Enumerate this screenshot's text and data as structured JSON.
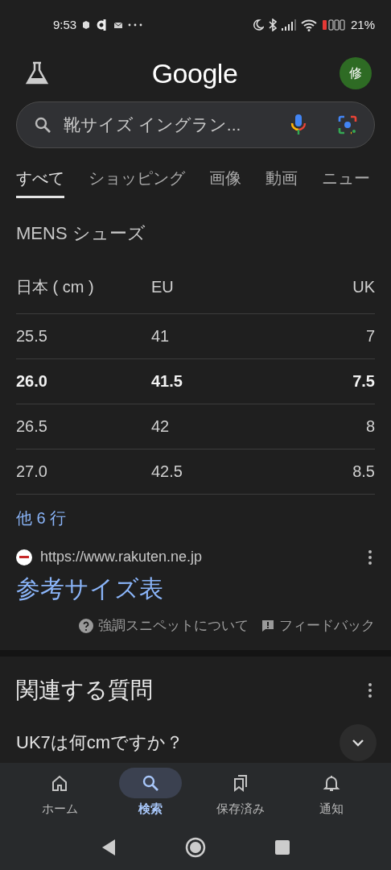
{
  "status_bar": {
    "time": "9:53",
    "battery": "21%"
  },
  "header": {
    "logo": "Google",
    "avatar": "修"
  },
  "search": {
    "value": "靴サイズ イングラン..."
  },
  "tabs": [
    {
      "label": "すべて",
      "selected": true
    },
    {
      "label": "ショッピング",
      "selected": false
    },
    {
      "label": "画像",
      "selected": false
    },
    {
      "label": "動画",
      "selected": false
    },
    {
      "label": "ニュー",
      "selected": false
    }
  ],
  "snippet": {
    "heading": "MENS シューズ",
    "table": {
      "columns": [
        "日本 ( cm )",
        "EU",
        "UK"
      ],
      "rows": [
        {
          "cells": [
            "25.5",
            "41",
            "7"
          ],
          "highlighted": false
        },
        {
          "cells": [
            "26.0",
            "41.5",
            "7.5"
          ],
          "highlighted": true
        },
        {
          "cells": [
            "26.5",
            "42",
            "8"
          ],
          "highlighted": false
        },
        {
          "cells": [
            "27.0",
            "42.5",
            "8.5"
          ],
          "highlighted": false
        }
      ]
    },
    "more_rows": "他 6 行",
    "source_url": "https://www.rakuten.ne.jp",
    "title": "参考サイズ表",
    "about": "強調スニペットについて",
    "feedback": "フィードバック"
  },
  "related": {
    "heading": "関連する質問",
    "questions": [
      "UK7は何cmですか？"
    ]
  },
  "bottom_nav": [
    {
      "label": "ホーム",
      "selected": false
    },
    {
      "label": "検索",
      "selected": true
    },
    {
      "label": "保存済み",
      "selected": false
    },
    {
      "label": "通知",
      "selected": false
    }
  ]
}
